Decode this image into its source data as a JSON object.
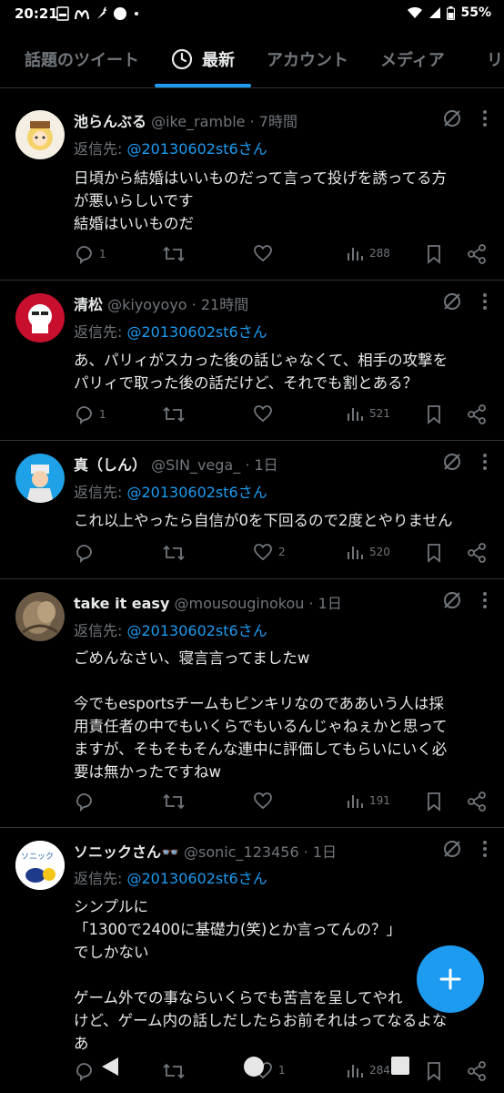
{
  "statusbar": {
    "time": "20:21",
    "battery": "55%"
  },
  "tabs": [
    {
      "label": "話題のツイート"
    },
    {
      "label": "最新"
    },
    {
      "label": "アカウント"
    },
    {
      "label": "メディア"
    },
    {
      "label": "リ"
    }
  ],
  "tweets": [
    {
      "name": "池らんぶる",
      "meta": "@ike_ramble · 7時間",
      "reply_prefix": "返信先: ",
      "reply_mention": "@20130602st6さん",
      "body": "日頃から結婚はいいものだって言って投げを誘ってる方\nが悪いらしいです\n結婚はいいものだ",
      "replies": "1",
      "retweets": "",
      "likes": "",
      "views": "288"
    },
    {
      "name": "清松",
      "meta": "@kiyoyoyo · 21時間",
      "reply_prefix": "返信先: ",
      "reply_mention": "@20130602st6さん",
      "body": "あ、パリィがスカった後の話じゃなくて、相手の攻撃を\nパリィで取った後の話だけど、それでも割とある？",
      "replies": "1",
      "retweets": "",
      "likes": "",
      "views": "521"
    },
    {
      "name": "真（しん）",
      "meta": "@SIN_vega_ · 1日",
      "reply_prefix": "返信先: ",
      "reply_mention": "@20130602st6さん",
      "body": "これ以上やったら自信が0を下回るので2度とやりません",
      "replies": "",
      "retweets": "",
      "likes": "2",
      "views": "520"
    },
    {
      "name": "take it easy",
      "meta": "@mousouginokou · 1日",
      "reply_prefix": "返信先: ",
      "reply_mention": "@20130602st6さん",
      "body": "ごめんなさい、寝言言ってましたw\n\n今でもesportsチームもピンキリなのでああいう人は採\n用責任者の中でもいくらでもいるんじゃねぇかと思って\nますが、そもそもそんな連中に評価してもらいにいく必\n要は無かったですねw",
      "replies": "",
      "retweets": "",
      "likes": "",
      "views": "191"
    },
    {
      "name": "ソニックさん👓",
      "meta": "@sonic_123456 · 1日",
      "reply_prefix": "返信先: ",
      "reply_mention": "@20130602st6さん",
      "body": "シンプルに\n「1300で2400に基礎力(笑)とか言ってんの？」\nでしかない\n\nゲーム外での事ならいくらでも苦言を呈してやれ\nけど、ゲーム内の話しだしたらお前それはってなるよな\nあ",
      "replies": "",
      "retweets": "",
      "likes": "1",
      "views": "284",
      "avatar_text": "ソニック"
    }
  ],
  "colors": {
    "accent": "#1d9bf0",
    "muted": "#71767b",
    "text": "#e7e9ea",
    "bg": "#000000",
    "divider": "#2f3336"
  }
}
